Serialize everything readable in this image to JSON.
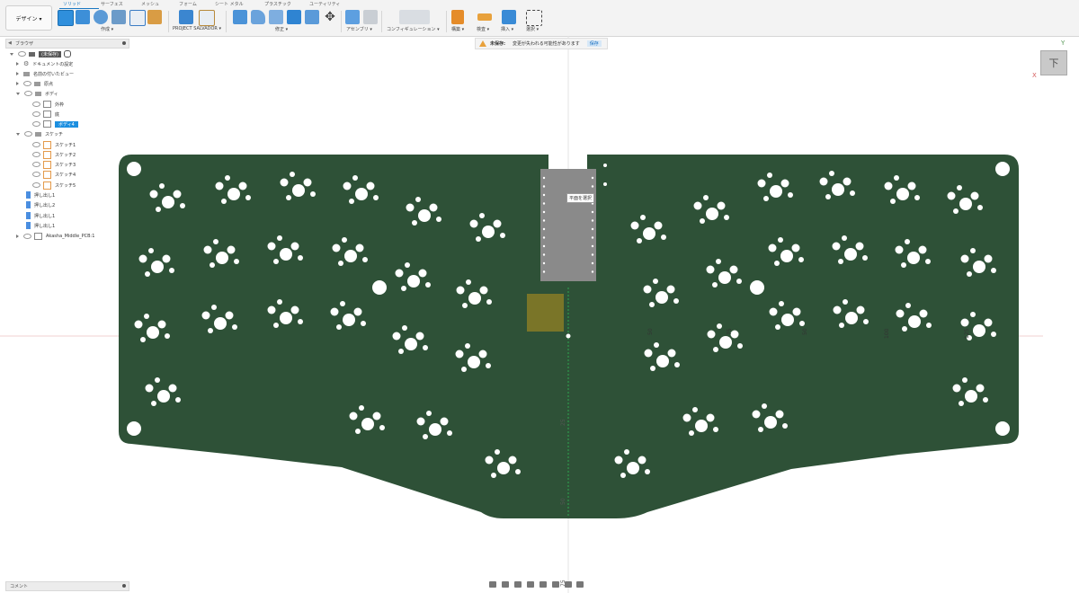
{
  "toolbar": {
    "design_label": "デザイン ▾",
    "tabs": [
      "ソリッド",
      "サーフェス",
      "メッシュ",
      "フォーム",
      "シート メタル",
      "プラスチック",
      "ユーティリティ"
    ],
    "groups": [
      "作成 ▾",
      "PROJECT SALVADOR ▾",
      "修正 ▾",
      "アセンブリ ▾",
      "コンフィギュレーション ▾",
      "構築 ▾",
      "検査 ▾",
      "挿入 ▾",
      "選択 ▾"
    ]
  },
  "browser": {
    "title": "ブラウザ",
    "root": "(未保存)",
    "items": [
      "ドキュメントの設定",
      "名前の付いたビュー",
      "原点",
      "ボディ",
      "外枠",
      "底",
      "ボディ4",
      "スケッチ",
      "スケッチ1",
      "スケッチ2",
      "スケッチ3",
      "スケッチ4",
      "スケッチ5",
      "押し出し1",
      "押し出し2",
      "押し出し1",
      "押し出し1",
      "Akasha_Middle_PCB:1"
    ]
  },
  "banner": {
    "label": "未保存:",
    "message": "変更が失われる可能性があります",
    "action": "保存"
  },
  "viewport": {
    "tooltip": "平面を選択",
    "viewcube_face": "下",
    "axis_y": "Y",
    "axis_x": "X",
    "ruler_labels": [
      "75",
      "50",
      "25",
      "50",
      "75",
      "100",
      "125",
      "50"
    ],
    "pcb_color": "#2e5137"
  },
  "comments": {
    "title": "コメント"
  }
}
